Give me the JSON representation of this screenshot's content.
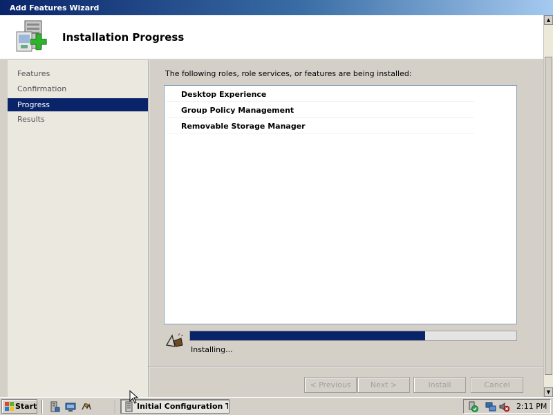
{
  "window": {
    "title": "Add Features Wizard",
    "header_title": "Installation Progress"
  },
  "nav": {
    "items": [
      {
        "label": "Features",
        "active": false
      },
      {
        "label": "Confirmation",
        "active": false
      },
      {
        "label": "Progress",
        "active": true
      },
      {
        "label": "Results",
        "active": false
      }
    ]
  },
  "content": {
    "intro": "The following roles, role services, or features are being installed:",
    "features": [
      "Desktop Experience",
      "Group Policy Management",
      "Removable Storage Manager"
    ],
    "progress": {
      "fraction": 0.72,
      "status": "Installing..."
    }
  },
  "buttons": {
    "previous": "< Previous",
    "next": "Next >",
    "install": "Install",
    "cancel": "Cancel"
  },
  "taskbar": {
    "start_label": "Start",
    "task_label": "Initial Configuration T...",
    "clock": "2:11 PM"
  },
  "icons": {
    "header": "server-add-icon",
    "progress": "installing-animation-icon"
  },
  "colors": {
    "accent": "#0a246a",
    "face": "#d4d0c8",
    "nav_bg": "#ebe8e0"
  }
}
